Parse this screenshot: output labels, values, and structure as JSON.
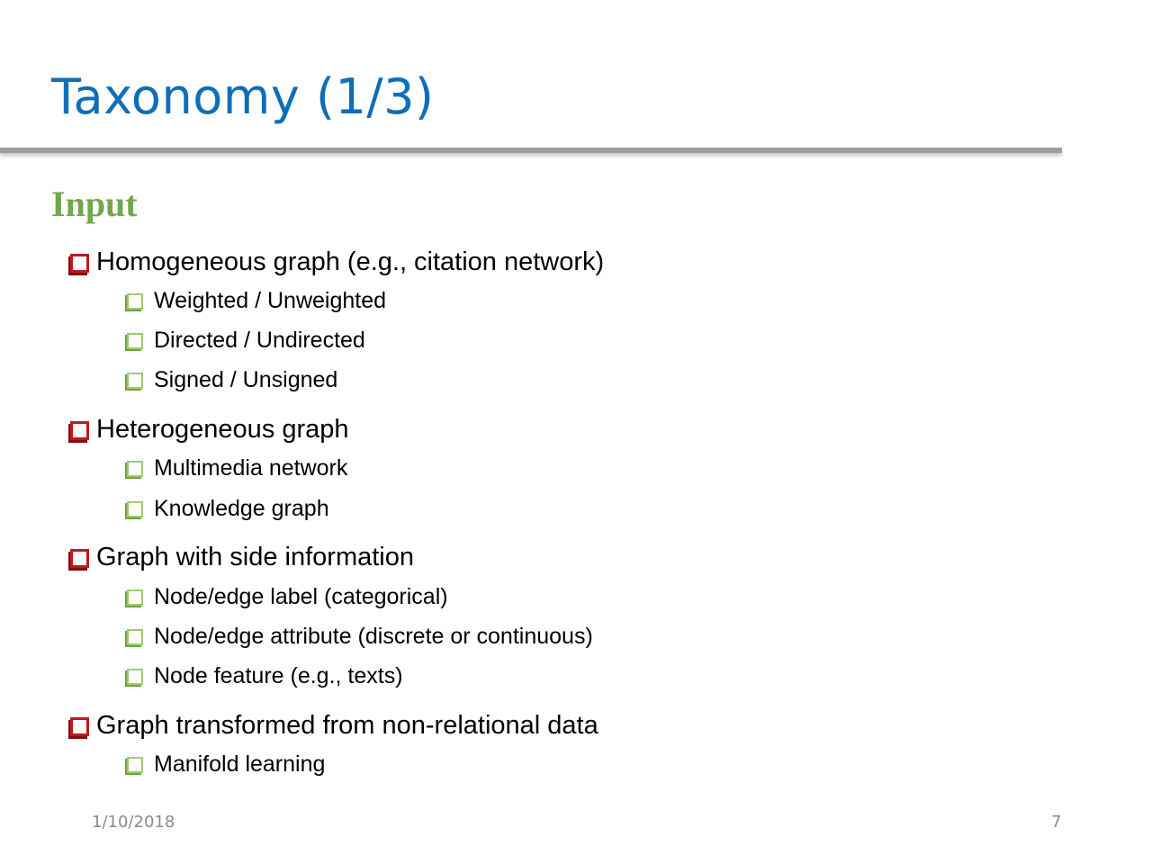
{
  "slide": {
    "title": "Taxonomy (1/3)",
    "section_heading": "Input",
    "colors": {
      "title": "#0e6eb8",
      "rule": "#a09fa0",
      "section_heading": "#70a84a",
      "level1_bullet": "#c0181e",
      "level2_bullet": "#9ccc6c",
      "footer_text": "#8a8a8a"
    },
    "bullets": [
      {
        "text": "Homogeneous graph (e.g., citation network)",
        "icon": "hollow-square-red",
        "children": [
          {
            "text": "Weighted / Unweighted",
            "icon": "hollow-square-green"
          },
          {
            "text": "Directed / Undirected",
            "icon": "hollow-square-green"
          },
          {
            "text": "Signed / Unsigned",
            "icon": "hollow-square-green"
          }
        ]
      },
      {
        "text": "Heterogeneous graph",
        "icon": "hollow-square-red",
        "children": [
          {
            "text": "Multimedia network",
            "icon": "hollow-square-green"
          },
          {
            "text": "Knowledge graph",
            "icon": "hollow-square-green"
          }
        ]
      },
      {
        "text": "Graph with side information",
        "icon": "hollow-square-red",
        "children": [
          {
            "text": "Node/edge label (categorical)",
            "icon": "hollow-square-green"
          },
          {
            "text": "Node/edge attribute (discrete or continuous)",
            "icon": "hollow-square-green"
          },
          {
            "text": "Node feature (e.g., texts)",
            "icon": "hollow-square-green"
          }
        ]
      },
      {
        "text": "Graph transformed from non-relational data",
        "icon": "hollow-square-red",
        "children": [
          {
            "text": "Manifold learning",
            "icon": "hollow-square-green"
          }
        ]
      }
    ],
    "footer": {
      "date": "1/10/2018",
      "page_number": "7"
    }
  }
}
